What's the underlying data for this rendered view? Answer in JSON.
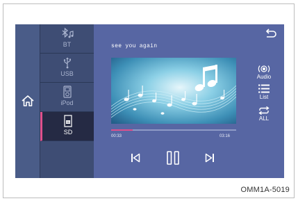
{
  "track": {
    "title": "see you again"
  },
  "sources": [
    {
      "label": "BT",
      "icon": "bluetooth-music-icon",
      "active": false
    },
    {
      "label": "USB",
      "icon": "usb-icon",
      "active": false
    },
    {
      "label": "iPod",
      "icon": "ipod-icon",
      "active": false
    },
    {
      "label": "SD",
      "icon": "sd-card-icon",
      "active": true
    }
  ],
  "side_buttons": [
    {
      "label": "Audio",
      "icon": "audio-icon"
    },
    {
      "label": "List",
      "icon": "list-icon"
    },
    {
      "label": "ALL",
      "icon": "repeat-icon"
    }
  ],
  "playback": {
    "elapsed": "00:33",
    "total": "03:16",
    "progress_fraction": 0.17
  },
  "colors": {
    "accent": "#e0508c",
    "screen_bg": "#5766a3",
    "source_bg": "#3e4d74",
    "active_source_bg": "#252a44"
  },
  "caption": "OMM1A-5019"
}
